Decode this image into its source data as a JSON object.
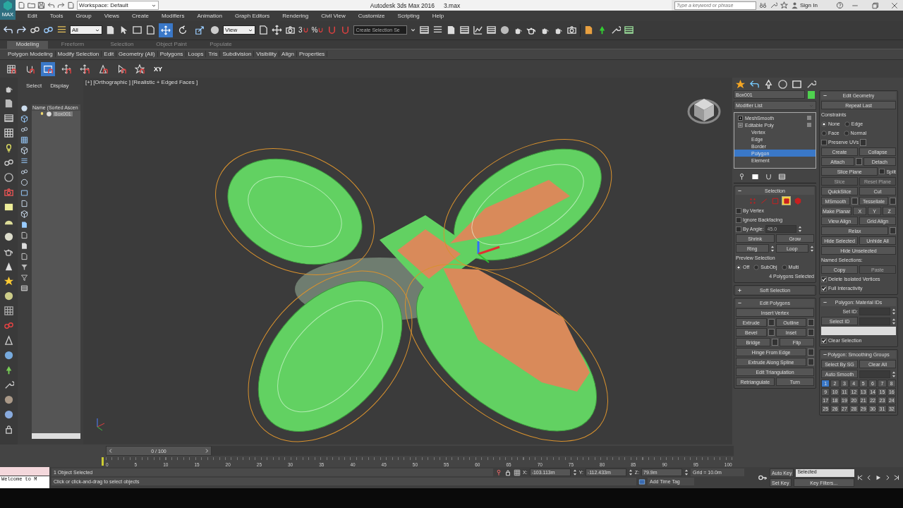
{
  "title_bar": {
    "app_icon_label": "MAX",
    "workspace": "Workspace: Default",
    "title": "Autodesk 3ds Max 2016",
    "file": "3.max",
    "search": {
      "placeholder": "Type a keyword or phrase"
    },
    "sign_in": "Sign In"
  },
  "menu": [
    "Edit",
    "Tools",
    "Group",
    "Views",
    "Create",
    "Modifiers",
    "Animation",
    "Graph Editors",
    "Rendering",
    "Civil View",
    "Customize",
    "Scripting",
    "Help"
  ],
  "main_toolbar": {
    "selection_filter": "All",
    "transform_tools": [
      {
        "selected": true
      },
      {
        "selected": false
      },
      {
        "selected": false
      }
    ],
    "reference_coord": "View",
    "snap_labels": [
      "3",
      "%"
    ],
    "named_selection": "Create Selection Se"
  },
  "ribbon": {
    "tabs": [
      {
        "label": "Modeling",
        "selected": true
      },
      {
        "label": "Freeform",
        "selected": false
      },
      {
        "label": "Selection",
        "selected": false
      },
      {
        "label": "Object Paint",
        "selected": false
      },
      {
        "label": "Populate",
        "selected": false
      }
    ],
    "panels": [
      "Polygon Modeling",
      "Modify Selection",
      "Edit",
      "Geometry (All)",
      "Polygons",
      "Loops",
      "Tris",
      "Subdivision",
      "Visibility",
      "Align",
      "Properties"
    ],
    "tools": [
      {
        "selected": false
      },
      {
        "selected": false
      },
      {
        "selected": true
      },
      {
        "selected": false
      },
      {
        "selected": false
      },
      {
        "selected": false
      },
      {
        "selected": false
      },
      {
        "selected": false
      },
      {
        "selected": false,
        "label": "XY"
      }
    ]
  },
  "scene_explorer": {
    "tabs": [
      "Select",
      "Display"
    ],
    "column": "Name (Sorted Ascen",
    "items": [
      {
        "name": "Box001",
        "selected": true
      }
    ]
  },
  "viewport": {
    "labels": [
      "[+]",
      "[Orthographic ]",
      "[Realistic + Edged Faces ]"
    ]
  },
  "command_panel": {
    "object_name": "Box001",
    "modifier_list": "Modifier List",
    "stack": [
      {
        "name": "MeshSmooth",
        "expanded": false
      },
      {
        "name": "Editable Poly",
        "expanded": true,
        "children": [
          {
            "name": "Vertex",
            "selected": false
          },
          {
            "name": "Edge",
            "selected": false
          },
          {
            "name": "Border",
            "selected": false
          },
          {
            "name": "Polygon",
            "selected": true
          },
          {
            "name": "Element",
            "selected": false
          }
        ]
      }
    ],
    "left_rollouts": [
      {
        "title": "Selection",
        "expanded": true,
        "subobjects": [
          {
            "selected": false
          },
          {
            "selected": false
          },
          {
            "selected": false
          },
          {
            "selected": true
          },
          {
            "selected": false
          }
        ],
        "rows": [
          [
            {
              "kind": "checkbox",
              "label": "By Vertex",
              "checked": false
            }
          ],
          [
            {
              "kind": "checkbox",
              "label": "Ignore Backfacing",
              "checked": false
            }
          ],
          [
            {
              "kind": "checkbox",
              "label": "By Angle:",
              "checked": false
            },
            {
              "kind": "spinner",
              "value": "45.0"
            }
          ],
          [
            {
              "kind": "button",
              "label": "Shrink",
              "disabled": false
            },
            {
              "kind": "button",
              "label": "Grow",
              "disabled": false
            }
          ],
          [
            {
              "kind": "spin_button",
              "label": "Ring",
              "disabled": false
            },
            {
              "kind": "spin_button",
              "label": "Loop",
              "disabled": false
            }
          ],
          [
            {
              "kind": "caption",
              "label": "Preview Selection"
            }
          ],
          [
            {
              "kind": "radio",
              "label": "Off",
              "selected": true
            },
            {
              "kind": "radio",
              "label": "SubObj",
              "selected": false
            },
            {
              "kind": "radio",
              "label": "Multi",
              "selected": false
            }
          ],
          [
            {
              "kind": "note",
              "label": "4 Polygons Selected"
            }
          ]
        ]
      },
      {
        "title": "Soft Selection",
        "expanded": false
      },
      {
        "title": "Edit Polygons",
        "expanded": true,
        "rows": [
          [
            {
              "kind": "button",
              "label": "Insert Vertex",
              "disabled": false
            }
          ],
          [
            {
              "kind": "option_button",
              "label": "Extrude",
              "disabled": false
            },
            {
              "kind": "option_button",
              "label": "Outline",
              "disabled": false
            }
          ],
          [
            {
              "kind": "option_button",
              "label": "Bevel",
              "disabled": false
            },
            {
              "kind": "option_button",
              "label": "Inset",
              "disabled": false
            }
          ],
          [
            {
              "kind": "option_button",
              "label": "Bridge",
              "disabled": false
            },
            {
              "kind": "button",
              "label": "Flip",
              "disabled": false
            }
          ],
          [
            {
              "kind": "option_button",
              "label": "Hinge From Edge",
              "disabled": false
            }
          ],
          [
            {
              "kind": "option_button",
              "label": "Extrude Along Spline",
              "disabled": false
            }
          ],
          [
            {
              "kind": "button",
              "label": "Edit Triangulation",
              "disabled": false
            }
          ],
          [
            {
              "kind": "button",
              "label": "Retriangulate",
              "disabled": false
            },
            {
              "kind": "button",
              "label": "Turn",
              "disabled": false
            }
          ]
        ]
      }
    ],
    "right_rollouts": [
      {
        "title": "Edit Geometry",
        "expanded": true,
        "rows": [
          [
            {
              "kind": "button",
              "label": "Repeat Last",
              "disabled": false
            }
          ],
          [
            {
              "kind": "caption",
              "label": "Constraints"
            }
          ],
          [
            {
              "kind": "radio",
              "label": "None",
              "selected": true
            },
            {
              "kind": "radio",
              "label": "Edge",
              "selected": false
            }
          ],
          [
            {
              "kind": "radio",
              "label": "Face",
              "selected": false
            },
            {
              "kind": "radio",
              "label": "Normal",
              "selected": false
            }
          ],
          [
            {
              "kind": "option_checkbox",
              "label": "Preserve UVs",
              "checked": false
            }
          ],
          [
            {
              "kind": "button",
              "label": "Create",
              "disabled": false
            },
            {
              "kind": "button",
              "label": "Collapse",
              "disabled": false
            }
          ],
          [
            {
              "kind": "option_button",
              "label": "Attach",
              "disabled": false
            },
            {
              "kind": "button",
              "label": "Detach",
              "disabled": false
            }
          ],
          [
            {
              "kind": "button",
              "label": "Slice Plane",
              "disabled": false
            },
            {
              "kind": "checkbox",
              "label": "Split",
              "checked": false
            }
          ],
          [
            {
              "kind": "button",
              "label": "Slice",
              "disabled": true
            },
            {
              "kind": "button",
              "label": "Reset Plane",
              "disabled": true
            }
          ],
          [
            {
              "kind": "button",
              "label": "QuickSlice",
              "disabled": false
            },
            {
              "kind": "button",
              "label": "Cut",
              "disabled": false
            }
          ],
          [
            {
              "kind": "option_button",
              "label": "MSmooth",
              "disabled": false
            },
            {
              "kind": "option_button",
              "label": "Tessellate",
              "disabled": false
            }
          ],
          [
            {
              "kind": "button",
              "label": "Make Planar",
              "disabled": false
            },
            {
              "kind": "button",
              "label": "X",
              "disabled": false
            },
            {
              "kind": "button",
              "label": "Y",
              "disabled": false
            },
            {
              "kind": "button",
              "label": "Z",
              "disabled": false
            }
          ],
          [
            {
              "kind": "button",
              "label": "View Align",
              "disabled": false
            },
            {
              "kind": "button",
              "label": "Grid Align",
              "disabled": false
            }
          ],
          [
            {
              "kind": "option_button",
              "label": "Relax",
              "disabled": false
            }
          ],
          [
            {
              "kind": "button",
              "label": "Hide Selected",
              "disabled": false
            },
            {
              "kind": "button",
              "label": "Unhide All",
              "disabled": false
            }
          ],
          [
            {
              "kind": "button",
              "label": "Hide Unselected",
              "disabled": false
            }
          ],
          [
            {
              "kind": "caption",
              "label": "Named Selections:"
            }
          ],
          [
            {
              "kind": "button",
              "label": "Copy",
              "disabled": false
            },
            {
              "kind": "button",
              "label": "Paste",
              "disabled": true
            }
          ],
          [
            {
              "kind": "checkbox",
              "label": "Delete Isolated Vertices",
              "checked": true
            }
          ],
          [
            {
              "kind": "checkbox",
              "label": "Full Interactivity",
              "checked": true
            }
          ]
        ]
      },
      {
        "title": "Polygon: Material IDs",
        "expanded": true,
        "rows": [
          [
            {
              "kind": "spinner",
              "label": "Set ID:"
            }
          ],
          [
            {
              "kind": "button",
              "label": "Select ID",
              "disabled": false
            },
            {
              "kind": "spinner"
            }
          ],
          [
            {
              "kind": "dropdown"
            }
          ],
          [
            {
              "kind": "checkbox",
              "label": "Clear Selection",
              "checked": true
            }
          ]
        ]
      },
      {
        "title": "Polygon: Smoothing Groups",
        "expanded": true,
        "groups": [
          {
            "label": "1",
            "selected": true
          },
          {
            "label": "2",
            "selected": false
          },
          {
            "label": "3",
            "selected": false
          },
          {
            "label": "4",
            "selected": false
          },
          {
            "label": "5",
            "selected": false
          },
          {
            "label": "6",
            "selected": false
          },
          {
            "label": "7",
            "selected": false
          },
          {
            "label": "8",
            "selected": false
          },
          {
            "label": "9",
            "selected": false
          },
          {
            "label": "10",
            "selected": false
          },
          {
            "label": "11",
            "selected": false
          },
          {
            "label": "12",
            "selected": false
          },
          {
            "label": "13",
            "selected": false
          },
          {
            "label": "14",
            "selected": false
          },
          {
            "label": "15",
            "selected": false
          },
          {
            "label": "16",
            "selected": false
          },
          {
            "label": "17",
            "selected": false
          },
          {
            "label": "18",
            "selected": false
          },
          {
            "label": "19",
            "selected": false
          },
          {
            "label": "20",
            "selected": false
          },
          {
            "label": "21",
            "selected": false
          },
          {
            "label": "22",
            "selected": false
          },
          {
            "label": "23",
            "selected": false
          },
          {
            "label": "24",
            "selected": false
          },
          {
            "label": "25",
            "selected": false
          },
          {
            "label": "26",
            "selected": false
          },
          {
            "label": "27",
            "selected": false
          },
          {
            "label": "28",
            "selected": false
          },
          {
            "label": "29",
            "selected": false
          },
          {
            "label": "30",
            "selected": false
          },
          {
            "label": "31",
            "selected": false
          },
          {
            "label": "32",
            "selected": false
          }
        ],
        "rows": [
          [
            {
              "kind": "button",
              "label": "Select By SG",
              "disabled": false
            },
            {
              "kind": "button",
              "label": "Clear All",
              "disabled": false
            }
          ],
          [
            {
              "kind": "button",
              "label": "Auto Smooth",
              "disabled": false
            },
            {
              "kind": "spinner"
            }
          ]
        ]
      }
    ]
  },
  "time_slider": {
    "frame": "0 / 100",
    "ticks": [
      "0",
      "5",
      "10",
      "15",
      "20",
      "25",
      "30",
      "35",
      "40",
      "45",
      "50",
      "55",
      "60",
      "65",
      "70",
      "75",
      "80",
      "85",
      "90",
      "95",
      "100"
    ]
  },
  "listener": {
    "text": "Welcome to M"
  },
  "status_bar": {
    "selection": "1 Object Selected",
    "prompt": "Click or click-and-drag to select objects",
    "coords": [
      {
        "axis": "X:",
        "value": "-103.113m"
      },
      {
        "axis": "Y:",
        "value": "-112.433m"
      },
      {
        "axis": "Z:",
        "value": "79.9m"
      }
    ],
    "grid": "Grid = 10.0m",
    "time_tag": "Add Time Tag",
    "auto_key": "Auto Key",
    "key_mode": "Selected",
    "set_key": "Set Key",
    "key_filters": "Key Filters..."
  }
}
